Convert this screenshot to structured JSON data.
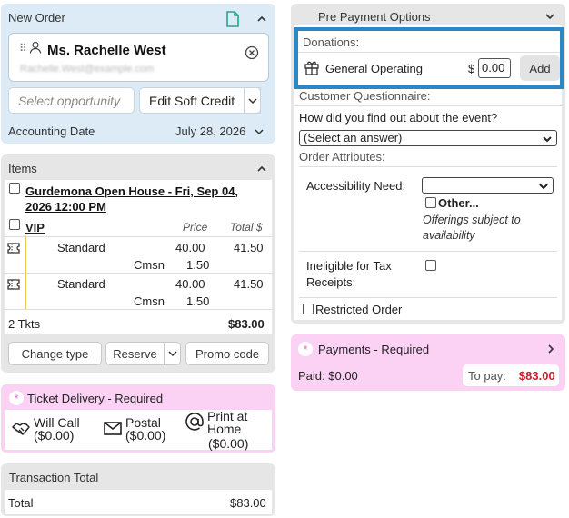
{
  "new_order": {
    "title": "New Order",
    "customer_name": "Ms. Rachelle West",
    "customer_email": "Rachelle.West@example.com",
    "opportunity_placeholder": "Select opportunity",
    "soft_credit_label": "Edit Soft Credit",
    "accounting_date_label": "Accounting Date",
    "accounting_date_value": "July 28, 2026"
  },
  "items": {
    "title": "Items",
    "event_title": "Gurdemona Open House - Fri, Sep 04, 2026 12:00 PM",
    "section": "VIP",
    "col_price": "Price",
    "col_total": "Total $",
    "tickets": [
      {
        "type": "Standard",
        "price": "40.00",
        "total": "41.50",
        "cmsn_label": "Cmsn",
        "cmsn": "1.50"
      },
      {
        "type": "Standard",
        "price": "40.00",
        "total": "41.50",
        "cmsn_label": "Cmsn",
        "cmsn": "1.50"
      }
    ],
    "count_label": "2 Tkts",
    "total": "$83.00",
    "buttons": {
      "change_type": "Change type",
      "reserve": "Reserve",
      "promo": "Promo code"
    }
  },
  "delivery": {
    "asterisk": "*",
    "title": "Ticket Delivery - Required",
    "options": [
      {
        "icon": "handshake-icon",
        "label": "Will Call",
        "price": "($0.00)"
      },
      {
        "icon": "envelope-icon",
        "label": "Postal",
        "price": "($0.00)"
      },
      {
        "icon": "at-sign-icon",
        "label": "Print at Home",
        "price": "($0.00)"
      }
    ]
  },
  "transaction": {
    "title": "Transaction Total",
    "label": "Total",
    "value": "$83.00"
  },
  "prepay": {
    "title": "Pre Payment Options",
    "donations_label": "Donations:",
    "fund_name": "General Operating",
    "currency": "$",
    "amount": "0.00",
    "add_label": "Add",
    "questionnaire_label": "Customer Questionnaire:",
    "question": "How did you find out about the event?",
    "answer_placeholder": "(Select an answer)",
    "attributes_label": "Order Attributes:",
    "accessibility_label": "Accessibility Need:",
    "other_label": "Other...",
    "offering_note": "Offerings subject to availability",
    "ineligible_label": "Ineligible for Tax Receipts:",
    "restricted_label": "Restricted Order"
  },
  "payments": {
    "asterisk": "*",
    "title": "Payments - Required",
    "paid": "Paid: $0.00",
    "to_pay_label": "To pay:",
    "to_pay_value": "$83.00"
  },
  "colors": {
    "blue_panel": "#dcebf5",
    "pink_panel": "#fbd1f4",
    "gray_panel": "#e6e6e6",
    "highlight": "#2b88c6",
    "due_red": "#d0192e"
  }
}
